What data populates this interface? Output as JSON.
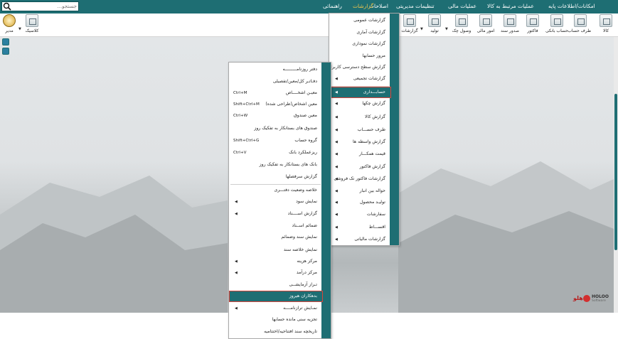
{
  "menubar": {
    "search_placeholder": "جستجو...",
    "items": [
      "امکانات/اطلاعات پایه",
      "عملیات مرتبط به کالا",
      "عملیات مالی",
      "تنظیمات مدیریتی",
      "اصلاحات",
      "گزارشات",
      "راهنمائی"
    ],
    "selected": "گزارشات"
  },
  "toolbar": {
    "right": [
      "کالا",
      "طرف حساب",
      "حساب بانکی",
      "فاکتور",
      "صدور سند",
      "امور مالی",
      "وصول چک",
      "تولید",
      "گزارشات"
    ],
    "left_user": "مدیر",
    "left_theme": "کلاسیک"
  },
  "reports_menu": {
    "items": [
      {
        "label": "گزارشات عمومی",
        "submenu": false
      },
      {
        "label": "گزارشات آماری",
        "submenu": false
      },
      {
        "label": "گزارشات نموداری",
        "submenu": false
      },
      {
        "label": "مرور حسابها",
        "submenu": false
      },
      {
        "label": "گزارش سطح دسترسی کاربران",
        "submenu": false
      },
      {
        "label": "گزارشات تجمیعی",
        "submenu": true
      },
      {
        "label": "حسابـــداری",
        "submenu": true,
        "highlighted": true
      },
      {
        "label": "گزارش چکها",
        "submenu": true
      },
      {
        "label": "گزارش کالا",
        "submenu": true
      },
      {
        "label": "طرف حســـاب",
        "submenu": true
      },
      {
        "label": "گزارش واسطه ها",
        "submenu": true
      },
      {
        "label": "قیمت همکـــار",
        "submenu": true
      },
      {
        "label": "گزارش فاکتور",
        "submenu": true
      },
      {
        "label": "گزارشات فاکتور تک فروشی",
        "submenu": true
      },
      {
        "label": "حواله بین انبار",
        "submenu": true
      },
      {
        "label": "تولیـد محصول",
        "submenu": true
      },
      {
        "label": "سفارشات",
        "submenu": true
      },
      {
        "label": "اقســـاط",
        "submenu": true
      },
      {
        "label": "گزارشات مالیاتی",
        "submenu": true
      }
    ]
  },
  "accounting_menu": {
    "items": [
      {
        "label": "دفتر روزنامـــــــــه",
        "shortcut": "",
        "submenu": false
      },
      {
        "label": "دفـاتـر کل/معین/تفصیلی",
        "shortcut": "",
        "submenu": false
      },
      {
        "label": "معیـن اشخــــاص",
        "shortcut": "Ctrl+M",
        "submenu": false
      },
      {
        "label": "معین اشخاص(طراحی شده)",
        "shortcut": "Shift+Ctrl+M",
        "submenu": false
      },
      {
        "label": "معین صندوق",
        "shortcut": "Ctrl+W",
        "submenu": false
      },
      {
        "label": "صندوق های بستانکار به تفکیک روز",
        "shortcut": "",
        "submenu": false
      },
      {
        "label": "گروه حساب",
        "shortcut": "Shift+Ctrl+G",
        "submenu": false
      },
      {
        "label": "ریزعملکرد بانک",
        "shortcut": "Ctrl+V",
        "submenu": false
      },
      {
        "label": "بانک های بستانکار به تفکیک روز",
        "shortcut": "",
        "submenu": false
      },
      {
        "label": "گزارش سرفصلها",
        "shortcut": "",
        "submenu": false
      },
      {
        "label": "خلاصه وضعیت دفتـــری",
        "shortcut": "",
        "submenu": false
      },
      {
        "label": "نمایش سود",
        "shortcut": "",
        "submenu": true
      },
      {
        "label": "گزارش اســــناد",
        "shortcut": "",
        "submenu": true
      },
      {
        "label": "ضمائم اســناد",
        "shortcut": "",
        "submenu": false
      },
      {
        "label": "نمایش سند وضمائم",
        "shortcut": "",
        "submenu": false
      },
      {
        "label": "نمایش خلاصه سند",
        "shortcut": "",
        "submenu": false
      },
      {
        "label": "مرکز هزینه",
        "shortcut": "",
        "submenu": true
      },
      {
        "label": "مرکز درآمد",
        "shortcut": "",
        "submenu": true
      },
      {
        "label": "تـراز آزمایشــی",
        "shortcut": "",
        "submenu": false
      },
      {
        "label": "بدهکاران هیروز",
        "shortcut": "",
        "submenu": false,
        "highlighted": true
      },
      {
        "label": "نمـایش ترازنامــــه",
        "shortcut": "",
        "submenu": true
      },
      {
        "label": "تجزیه سنی مانده حسابها",
        "shortcut": "",
        "submenu": false
      },
      {
        "label": "تاریخچه سند افتتاحیه/اختتامیه",
        "shortcut": "",
        "submenu": false
      }
    ]
  },
  "logo": {
    "fa": "هلو",
    "en": "HOLOO",
    "en2": "Software"
  },
  "colors": {
    "teal": "#1e6e73",
    "selected_menu_text": "#f4c74a",
    "highlight_border": "#d6453c"
  }
}
